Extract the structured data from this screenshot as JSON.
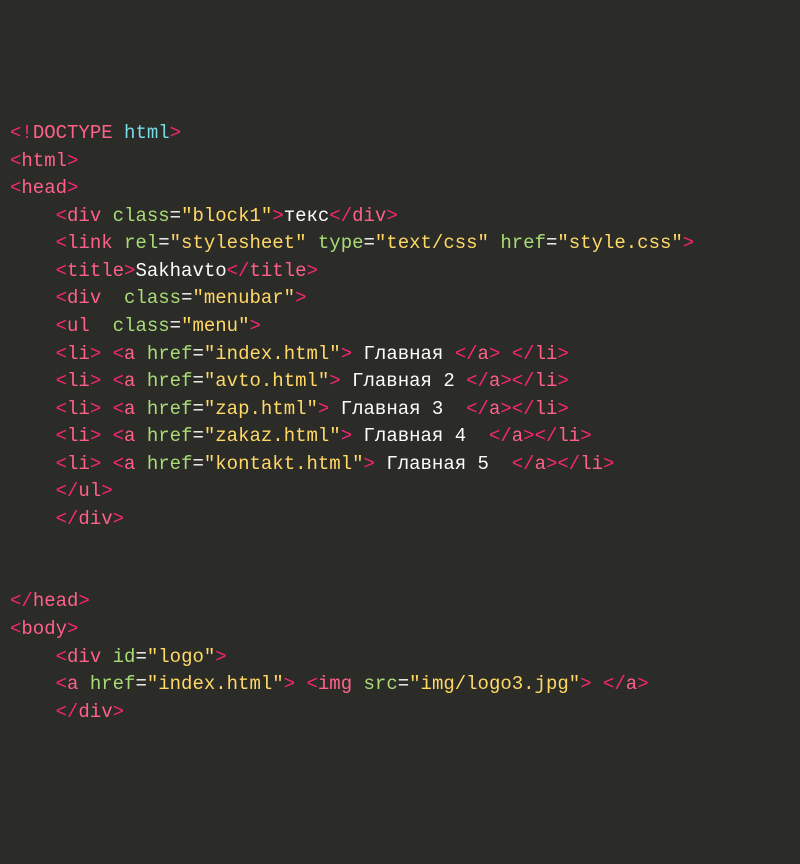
{
  "code": {
    "lines": [
      {
        "indent": 0,
        "segs": [
          {
            "t": "<!",
            "c": "pn"
          },
          {
            "t": "DOCTYPE",
            "c": "tg"
          },
          {
            "t": " html",
            "c": "kw"
          },
          {
            "t": ">",
            "c": "pn"
          }
        ]
      },
      {
        "indent": 0,
        "segs": [
          {
            "t": "<",
            "c": "pn"
          },
          {
            "t": "html",
            "c": "tg"
          },
          {
            "t": ">",
            "c": "pn"
          }
        ]
      },
      {
        "indent": 0,
        "segs": [
          {
            "t": "<",
            "c": "pn"
          },
          {
            "t": "head",
            "c": "tg"
          },
          {
            "t": ">",
            "c": "pn"
          }
        ]
      },
      {
        "indent": 1,
        "segs": [
          {
            "t": "<",
            "c": "pn"
          },
          {
            "t": "div",
            "c": "tg"
          },
          {
            "t": " ",
            "c": "tx"
          },
          {
            "t": "class",
            "c": "at"
          },
          {
            "t": "=",
            "c": "eq"
          },
          {
            "t": "\"block1\"",
            "c": "st"
          },
          {
            "t": ">",
            "c": "pn"
          },
          {
            "t": "текс",
            "c": "tx"
          },
          {
            "t": "</",
            "c": "pn"
          },
          {
            "t": "div",
            "c": "tg"
          },
          {
            "t": ">",
            "c": "pn"
          }
        ]
      },
      {
        "indent": 1,
        "segs": [
          {
            "t": "<",
            "c": "pn"
          },
          {
            "t": "link",
            "c": "tg"
          },
          {
            "t": " ",
            "c": "tx"
          },
          {
            "t": "rel",
            "c": "at"
          },
          {
            "t": "=",
            "c": "eq"
          },
          {
            "t": "\"stylesheet\"",
            "c": "st"
          },
          {
            "t": " ",
            "c": "tx"
          },
          {
            "t": "type",
            "c": "at"
          },
          {
            "t": "=",
            "c": "eq"
          },
          {
            "t": "\"text/css\"",
            "c": "st"
          },
          {
            "t": " ",
            "c": "tx"
          },
          {
            "t": "href",
            "c": "at"
          },
          {
            "t": "=",
            "c": "eq"
          },
          {
            "t": "\"style.css\"",
            "c": "st"
          },
          {
            "t": ">",
            "c": "pn"
          }
        ]
      },
      {
        "indent": 1,
        "segs": [
          {
            "t": "<",
            "c": "pn"
          },
          {
            "t": "title",
            "c": "tg"
          },
          {
            "t": ">",
            "c": "pn"
          },
          {
            "t": "Sakhavto",
            "c": "tx"
          },
          {
            "t": "</",
            "c": "pn"
          },
          {
            "t": "title",
            "c": "tg"
          },
          {
            "t": ">",
            "c": "pn"
          }
        ]
      },
      {
        "indent": 1,
        "segs": [
          {
            "t": "<",
            "c": "pn"
          },
          {
            "t": "div",
            "c": "tg"
          },
          {
            "t": "  ",
            "c": "tx"
          },
          {
            "t": "class",
            "c": "at"
          },
          {
            "t": "=",
            "c": "eq"
          },
          {
            "t": "\"menubar\"",
            "c": "st"
          },
          {
            "t": ">",
            "c": "pn"
          }
        ]
      },
      {
        "indent": 1,
        "segs": [
          {
            "t": "<",
            "c": "pn"
          },
          {
            "t": "ul",
            "c": "tg"
          },
          {
            "t": "  ",
            "c": "tx"
          },
          {
            "t": "class",
            "c": "at"
          },
          {
            "t": "=",
            "c": "eq"
          },
          {
            "t": "\"menu\"",
            "c": "st"
          },
          {
            "t": ">",
            "c": "pn"
          }
        ]
      },
      {
        "indent": 1,
        "segs": [
          {
            "t": "<",
            "c": "pn"
          },
          {
            "t": "li",
            "c": "tg"
          },
          {
            "t": ">",
            "c": "pn"
          },
          {
            "t": " ",
            "c": "tx"
          },
          {
            "t": "<",
            "c": "pn"
          },
          {
            "t": "a",
            "c": "tg"
          },
          {
            "t": " ",
            "c": "tx"
          },
          {
            "t": "href",
            "c": "at"
          },
          {
            "t": "=",
            "c": "eq"
          },
          {
            "t": "\"index.html\"",
            "c": "st"
          },
          {
            "t": ">",
            "c": "pn"
          },
          {
            "t": " Главная ",
            "c": "tx"
          },
          {
            "t": "</",
            "c": "pn"
          },
          {
            "t": "a",
            "c": "tg"
          },
          {
            "t": ">",
            "c": "pn"
          },
          {
            "t": " ",
            "c": "tx"
          },
          {
            "t": "</",
            "c": "pn"
          },
          {
            "t": "li",
            "c": "tg"
          },
          {
            "t": ">",
            "c": "pn"
          }
        ]
      },
      {
        "indent": 1,
        "segs": [
          {
            "t": "<",
            "c": "pn"
          },
          {
            "t": "li",
            "c": "tg"
          },
          {
            "t": ">",
            "c": "pn"
          },
          {
            "t": " ",
            "c": "tx"
          },
          {
            "t": "<",
            "c": "pn"
          },
          {
            "t": "a",
            "c": "tg"
          },
          {
            "t": " ",
            "c": "tx"
          },
          {
            "t": "href",
            "c": "at"
          },
          {
            "t": "=",
            "c": "eq"
          },
          {
            "t": "\"avto.html\"",
            "c": "st"
          },
          {
            "t": ">",
            "c": "pn"
          },
          {
            "t": " Главная 2 ",
            "c": "tx"
          },
          {
            "t": "</",
            "c": "pn"
          },
          {
            "t": "a",
            "c": "tg"
          },
          {
            "t": ">",
            "c": "pn"
          },
          {
            "t": "</",
            "c": "pn"
          },
          {
            "t": "li",
            "c": "tg"
          },
          {
            "t": ">",
            "c": "pn"
          }
        ]
      },
      {
        "indent": 1,
        "segs": [
          {
            "t": "<",
            "c": "pn"
          },
          {
            "t": "li",
            "c": "tg"
          },
          {
            "t": ">",
            "c": "pn"
          },
          {
            "t": " ",
            "c": "tx"
          },
          {
            "t": "<",
            "c": "pn"
          },
          {
            "t": "a",
            "c": "tg"
          },
          {
            "t": " ",
            "c": "tx"
          },
          {
            "t": "href",
            "c": "at"
          },
          {
            "t": "=",
            "c": "eq"
          },
          {
            "t": "\"zap.html\"",
            "c": "st"
          },
          {
            "t": ">",
            "c": "pn"
          },
          {
            "t": " Главная 3  ",
            "c": "tx"
          },
          {
            "t": "</",
            "c": "pn"
          },
          {
            "t": "a",
            "c": "tg"
          },
          {
            "t": ">",
            "c": "pn"
          },
          {
            "t": "</",
            "c": "pn"
          },
          {
            "t": "li",
            "c": "tg"
          },
          {
            "t": ">",
            "c": "pn"
          }
        ]
      },
      {
        "indent": 1,
        "segs": [
          {
            "t": "<",
            "c": "pn"
          },
          {
            "t": "li",
            "c": "tg"
          },
          {
            "t": ">",
            "c": "pn"
          },
          {
            "t": " ",
            "c": "tx"
          },
          {
            "t": "<",
            "c": "pn"
          },
          {
            "t": "a",
            "c": "tg"
          },
          {
            "t": " ",
            "c": "tx"
          },
          {
            "t": "href",
            "c": "at"
          },
          {
            "t": "=",
            "c": "eq"
          },
          {
            "t": "\"zakaz.html\"",
            "c": "st"
          },
          {
            "t": ">",
            "c": "pn"
          },
          {
            "t": " Главная 4  ",
            "c": "tx"
          },
          {
            "t": "</",
            "c": "pn"
          },
          {
            "t": "a",
            "c": "tg"
          },
          {
            "t": ">",
            "c": "pn"
          },
          {
            "t": "</",
            "c": "pn"
          },
          {
            "t": "li",
            "c": "tg"
          },
          {
            "t": ">",
            "c": "pn"
          }
        ]
      },
      {
        "indent": 1,
        "segs": [
          {
            "t": "<",
            "c": "pn"
          },
          {
            "t": "li",
            "c": "tg"
          },
          {
            "t": ">",
            "c": "pn"
          },
          {
            "t": " ",
            "c": "tx"
          },
          {
            "t": "<",
            "c": "pn"
          },
          {
            "t": "a",
            "c": "tg"
          },
          {
            "t": " ",
            "c": "tx"
          },
          {
            "t": "href",
            "c": "at"
          },
          {
            "t": "=",
            "c": "eq"
          },
          {
            "t": "\"kontakt.html\"",
            "c": "st"
          },
          {
            "t": ">",
            "c": "pn"
          },
          {
            "t": " Главная 5  ",
            "c": "tx"
          },
          {
            "t": "</",
            "c": "pn"
          },
          {
            "t": "a",
            "c": "tg"
          },
          {
            "t": ">",
            "c": "pn"
          },
          {
            "t": "</",
            "c": "pn"
          },
          {
            "t": "li",
            "c": "tg"
          },
          {
            "t": ">",
            "c": "pn"
          }
        ]
      },
      {
        "indent": 1,
        "segs": [
          {
            "t": "</",
            "c": "pn"
          },
          {
            "t": "ul",
            "c": "tg"
          },
          {
            "t": ">",
            "c": "pn"
          }
        ]
      },
      {
        "indent": 1,
        "segs": [
          {
            "t": "</",
            "c": "pn"
          },
          {
            "t": "div",
            "c": "tg"
          },
          {
            "t": ">",
            "c": "pn"
          }
        ]
      },
      {
        "indent": 0,
        "segs": []
      },
      {
        "indent": 0,
        "segs": []
      },
      {
        "indent": 0,
        "segs": [
          {
            "t": "</",
            "c": "pn"
          },
          {
            "t": "head",
            "c": "tg"
          },
          {
            "t": ">",
            "c": "pn"
          }
        ]
      },
      {
        "indent": 0,
        "segs": [
          {
            "t": "<",
            "c": "pn"
          },
          {
            "t": "body",
            "c": "tg"
          },
          {
            "t": ">",
            "c": "pn"
          }
        ]
      },
      {
        "indent": 1,
        "segs": [
          {
            "t": "<",
            "c": "pn"
          },
          {
            "t": "div",
            "c": "tg"
          },
          {
            "t": " ",
            "c": "tx"
          },
          {
            "t": "id",
            "c": "at"
          },
          {
            "t": "=",
            "c": "eq"
          },
          {
            "t": "\"logo\"",
            "c": "st"
          },
          {
            "t": ">",
            "c": "pn"
          }
        ]
      },
      {
        "indent": 1,
        "segs": [
          {
            "t": "<",
            "c": "pn"
          },
          {
            "t": "a",
            "c": "tg"
          },
          {
            "t": " ",
            "c": "tx"
          },
          {
            "t": "href",
            "c": "at"
          },
          {
            "t": "=",
            "c": "eq"
          },
          {
            "t": "\"index.html\"",
            "c": "st"
          },
          {
            "t": ">",
            "c": "pn"
          },
          {
            "t": " ",
            "c": "tx"
          },
          {
            "t": "<",
            "c": "pn"
          },
          {
            "t": "img",
            "c": "tg"
          },
          {
            "t": " ",
            "c": "tx"
          },
          {
            "t": "src",
            "c": "at"
          },
          {
            "t": "=",
            "c": "eq"
          },
          {
            "t": "\"img/logo3.jpg\"",
            "c": "st"
          },
          {
            "t": ">",
            "c": "pn"
          },
          {
            "t": " ",
            "c": "tx"
          },
          {
            "t": "</",
            "c": "pn"
          },
          {
            "t": "a",
            "c": "tg"
          },
          {
            "t": ">",
            "c": "pn"
          }
        ]
      },
      {
        "indent": 1,
        "segs": [
          {
            "t": "</",
            "c": "pn"
          },
          {
            "t": "div",
            "c": "tg"
          },
          {
            "t": ">",
            "c": "pn"
          }
        ]
      }
    ]
  }
}
